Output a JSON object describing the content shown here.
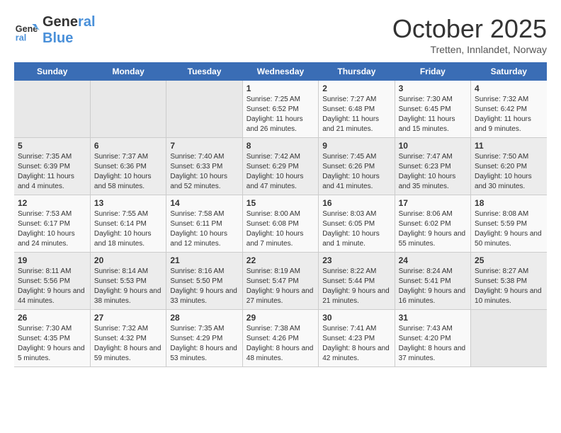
{
  "header": {
    "logo_general": "General",
    "logo_blue": "Blue",
    "month": "October 2025",
    "location": "Tretten, Innlandet, Norway"
  },
  "weekdays": [
    "Sunday",
    "Monday",
    "Tuesday",
    "Wednesday",
    "Thursday",
    "Friday",
    "Saturday"
  ],
  "weeks": [
    [
      {
        "day": "",
        "info": ""
      },
      {
        "day": "",
        "info": ""
      },
      {
        "day": "",
        "info": ""
      },
      {
        "day": "1",
        "info": "Sunrise: 7:25 AM\nSunset: 6:52 PM\nDaylight: 11 hours and 26 minutes."
      },
      {
        "day": "2",
        "info": "Sunrise: 7:27 AM\nSunset: 6:48 PM\nDaylight: 11 hours and 21 minutes."
      },
      {
        "day": "3",
        "info": "Sunrise: 7:30 AM\nSunset: 6:45 PM\nDaylight: 11 hours and 15 minutes."
      },
      {
        "day": "4",
        "info": "Sunrise: 7:32 AM\nSunset: 6:42 PM\nDaylight: 11 hours and 9 minutes."
      }
    ],
    [
      {
        "day": "5",
        "info": "Sunrise: 7:35 AM\nSunset: 6:39 PM\nDaylight: 11 hours and 4 minutes."
      },
      {
        "day": "6",
        "info": "Sunrise: 7:37 AM\nSunset: 6:36 PM\nDaylight: 10 hours and 58 minutes."
      },
      {
        "day": "7",
        "info": "Sunrise: 7:40 AM\nSunset: 6:33 PM\nDaylight: 10 hours and 52 minutes."
      },
      {
        "day": "8",
        "info": "Sunrise: 7:42 AM\nSunset: 6:29 PM\nDaylight: 10 hours and 47 minutes."
      },
      {
        "day": "9",
        "info": "Sunrise: 7:45 AM\nSunset: 6:26 PM\nDaylight: 10 hours and 41 minutes."
      },
      {
        "day": "10",
        "info": "Sunrise: 7:47 AM\nSunset: 6:23 PM\nDaylight: 10 hours and 35 minutes."
      },
      {
        "day": "11",
        "info": "Sunrise: 7:50 AM\nSunset: 6:20 PM\nDaylight: 10 hours and 30 minutes."
      }
    ],
    [
      {
        "day": "12",
        "info": "Sunrise: 7:53 AM\nSunset: 6:17 PM\nDaylight: 10 hours and 24 minutes."
      },
      {
        "day": "13",
        "info": "Sunrise: 7:55 AM\nSunset: 6:14 PM\nDaylight: 10 hours and 18 minutes."
      },
      {
        "day": "14",
        "info": "Sunrise: 7:58 AM\nSunset: 6:11 PM\nDaylight: 10 hours and 12 minutes."
      },
      {
        "day": "15",
        "info": "Sunrise: 8:00 AM\nSunset: 6:08 PM\nDaylight: 10 hours and 7 minutes."
      },
      {
        "day": "16",
        "info": "Sunrise: 8:03 AM\nSunset: 6:05 PM\nDaylight: 10 hours and 1 minute."
      },
      {
        "day": "17",
        "info": "Sunrise: 8:06 AM\nSunset: 6:02 PM\nDaylight: 9 hours and 55 minutes."
      },
      {
        "day": "18",
        "info": "Sunrise: 8:08 AM\nSunset: 5:59 PM\nDaylight: 9 hours and 50 minutes."
      }
    ],
    [
      {
        "day": "19",
        "info": "Sunrise: 8:11 AM\nSunset: 5:56 PM\nDaylight: 9 hours and 44 minutes."
      },
      {
        "day": "20",
        "info": "Sunrise: 8:14 AM\nSunset: 5:53 PM\nDaylight: 9 hours and 38 minutes."
      },
      {
        "day": "21",
        "info": "Sunrise: 8:16 AM\nSunset: 5:50 PM\nDaylight: 9 hours and 33 minutes."
      },
      {
        "day": "22",
        "info": "Sunrise: 8:19 AM\nSunset: 5:47 PM\nDaylight: 9 hours and 27 minutes."
      },
      {
        "day": "23",
        "info": "Sunrise: 8:22 AM\nSunset: 5:44 PM\nDaylight: 9 hours and 21 minutes."
      },
      {
        "day": "24",
        "info": "Sunrise: 8:24 AM\nSunset: 5:41 PM\nDaylight: 9 hours and 16 minutes."
      },
      {
        "day": "25",
        "info": "Sunrise: 8:27 AM\nSunset: 5:38 PM\nDaylight: 9 hours and 10 minutes."
      }
    ],
    [
      {
        "day": "26",
        "info": "Sunrise: 7:30 AM\nSunset: 4:35 PM\nDaylight: 9 hours and 5 minutes."
      },
      {
        "day": "27",
        "info": "Sunrise: 7:32 AM\nSunset: 4:32 PM\nDaylight: 8 hours and 59 minutes."
      },
      {
        "day": "28",
        "info": "Sunrise: 7:35 AM\nSunset: 4:29 PM\nDaylight: 8 hours and 53 minutes."
      },
      {
        "day": "29",
        "info": "Sunrise: 7:38 AM\nSunset: 4:26 PM\nDaylight: 8 hours and 48 minutes."
      },
      {
        "day": "30",
        "info": "Sunrise: 7:41 AM\nSunset: 4:23 PM\nDaylight: 8 hours and 42 minutes."
      },
      {
        "day": "31",
        "info": "Sunrise: 7:43 AM\nSunset: 4:20 PM\nDaylight: 8 hours and 37 minutes."
      },
      {
        "day": "",
        "info": ""
      }
    ]
  ]
}
